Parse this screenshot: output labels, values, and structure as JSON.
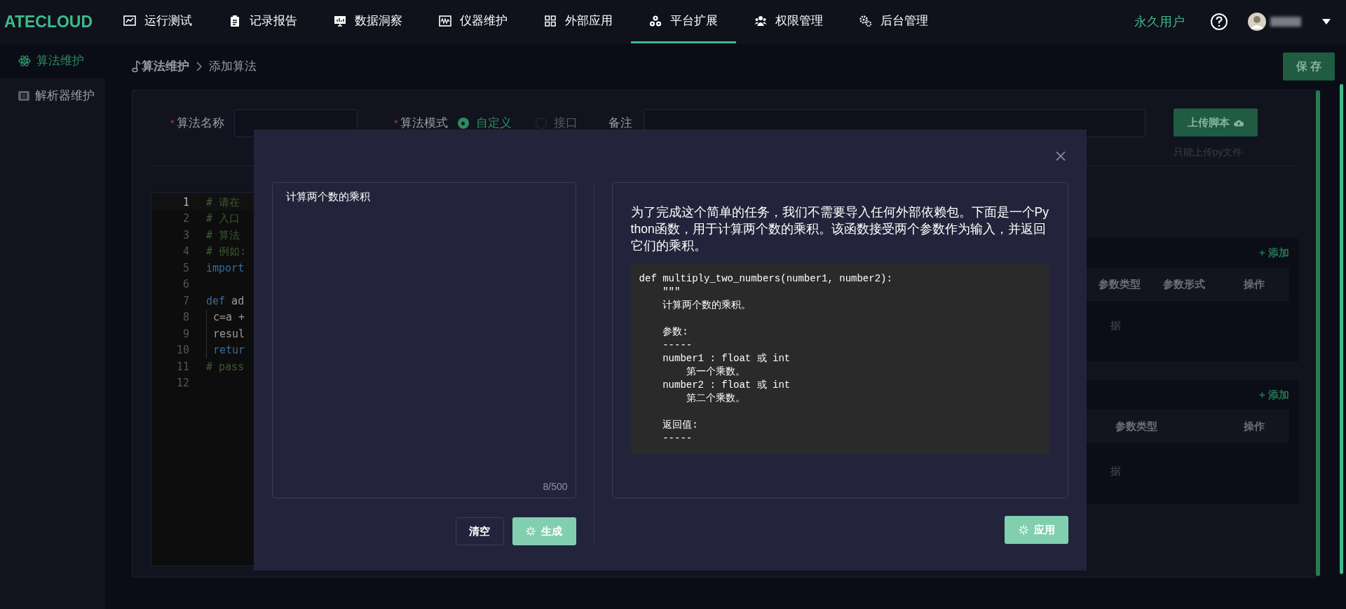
{
  "nav": {
    "logo": "ATECLOUD",
    "items": [
      {
        "label": "运行测试",
        "kind": "chart",
        "selected": false
      },
      {
        "label": "记录报告",
        "kind": "clipboard",
        "selected": false
      },
      {
        "label": "数据洞察",
        "kind": "monitor",
        "selected": false
      },
      {
        "label": "仪器维护",
        "kind": "wave",
        "selected": false
      },
      {
        "label": "外部应用",
        "kind": "grid",
        "selected": false
      },
      {
        "label": "平台扩展",
        "kind": "cluster",
        "selected": true
      },
      {
        "label": "权限管理",
        "kind": "users",
        "selected": false
      },
      {
        "label": "后台管理",
        "kind": "gears",
        "selected": false
      }
    ],
    "user_type": "永久用户"
  },
  "sidebar": {
    "items": [
      {
        "label": "算法维护",
        "kind": "atom",
        "selected": true
      },
      {
        "label": "解析器维护",
        "kind": "chip",
        "selected": false
      }
    ]
  },
  "breadcrumb": [
    "算法维护",
    "添加算法"
  ],
  "save_button": "保 存",
  "form": {
    "name_field": {
      "label": "算法名称",
      "required_mark": "*"
    },
    "mode": {
      "label": "算法模式",
      "required_mark": "*",
      "options": [
        {
          "label": "自定义",
          "selected": true
        },
        {
          "label": "接口",
          "selected": false
        }
      ]
    },
    "note_field": {
      "label": "备注"
    },
    "upload_button": "上传脚本",
    "upload_hint": "只能上传py文件"
  },
  "editor": {
    "lines": [
      {
        "number": "1",
        "current": true,
        "indent": false,
        "tokens": [
          {
            "text": "# 请在",
            "kind": "comment"
          }
        ]
      },
      {
        "number": "2",
        "current": false,
        "indent": false,
        "tokens": [
          {
            "text": "# 入口",
            "kind": "comment"
          }
        ]
      },
      {
        "number": "3",
        "current": false,
        "indent": false,
        "tokens": [
          {
            "text": "# 算法",
            "kind": "comment"
          }
        ]
      },
      {
        "number": "4",
        "current": false,
        "indent": false,
        "tokens": [
          {
            "text": "# 例如:",
            "kind": "comment"
          }
        ]
      },
      {
        "number": "5",
        "current": false,
        "indent": false,
        "tokens": [
          {
            "text": "import",
            "kind": "keyword"
          }
        ]
      },
      {
        "number": "6",
        "current": false,
        "indent": false
      },
      {
        "number": "7",
        "current": false,
        "indent": false,
        "tokens": [
          {
            "text": "def",
            "kind": "keyword"
          },
          {
            "text": " ad",
            "kind": "plain"
          }
        ]
      },
      {
        "number": "8",
        "current": false,
        "indent": true,
        "tokens": [
          {
            "text": "c=a +",
            "kind": "plain"
          }
        ]
      },
      {
        "number": "9",
        "current": false,
        "indent": true,
        "tokens": [
          {
            "text": "resul",
            "kind": "plain"
          }
        ]
      },
      {
        "number": "10",
        "current": false,
        "indent": true,
        "tokens": [
          {
            "text": "retur",
            "kind": "keyword"
          }
        ]
      },
      {
        "number": "11",
        "current": false,
        "indent": false,
        "tokens": [
          {
            "text": "# pass",
            "kind": "comment"
          }
        ]
      },
      {
        "number": "12",
        "current": false,
        "indent": false
      }
    ]
  },
  "param_tables": [
    {
      "add_link": "+ 添加",
      "columns": [
        {
          "label": "参数类型"
        },
        {
          "label": "参数形式"
        },
        {
          "label": "操作"
        }
      ],
      "empty_text": "据"
    },
    {
      "add_link": "+ 添加",
      "columns": [
        {
          "label": "参数类型"
        },
        {
          "label": "操作"
        }
      ],
      "empty_text": "据"
    }
  ],
  "dialog": {
    "prompt": {
      "value": "计算两个数的乘积",
      "counter": "8/500"
    },
    "clear_button": "清空",
    "generate_button": "生成",
    "answer": {
      "text": "为了完成这个简单的任务，我们不需要导入任何外部依赖包。下面是一个Python函数，用于计算两个数的乘积。该函数接受两个参数作为输入，并返回它们的乘积。",
      "code_lines": [
        {
          "kind": "text",
          "text": "def multiply_two_numbers(number1, number2):"
        },
        {
          "kind": "text",
          "text": "    \"\"\""
        },
        {
          "kind": "text",
          "text": "    计算两个数的乘积。"
        },
        {
          "kind": "blank"
        },
        {
          "kind": "text",
          "text": "    参数:"
        },
        {
          "kind": "text",
          "text": "    -----"
        },
        {
          "kind": "text",
          "text": "    number1 : float 或 int"
        },
        {
          "kind": "text",
          "text": "        第一个乘数。"
        },
        {
          "kind": "text",
          "text": "    number2 : float 或 int"
        },
        {
          "kind": "text",
          "text": "        第二个乘数。"
        },
        {
          "kind": "blank"
        },
        {
          "kind": "text",
          "text": "    返回值:"
        },
        {
          "kind": "text",
          "text": "    -----"
        }
      ]
    },
    "apply_button": "应用"
  }
}
